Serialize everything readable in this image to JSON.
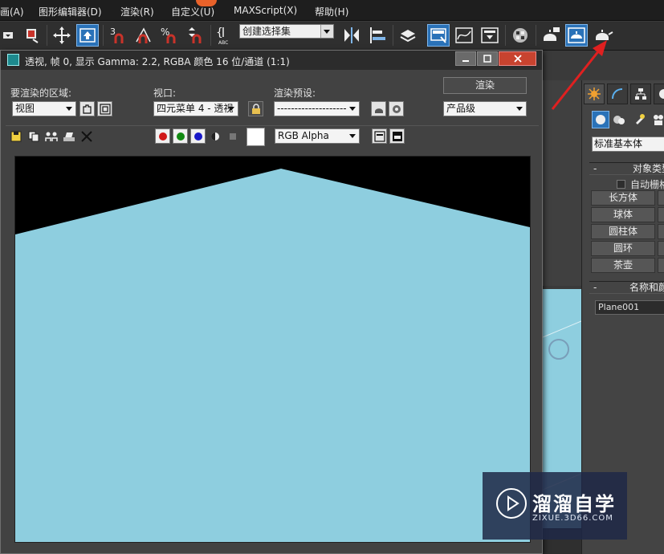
{
  "menu": {
    "items": [
      "画(A)",
      "图形编辑器(D)",
      "渲染(R)",
      "自定义(U)",
      "MAXScript(X)",
      "帮助(H)"
    ]
  },
  "toolbar": {
    "snap_labels": [
      "3",
      "%",
      "ABC"
    ],
    "named_selection_set": "创建选择集"
  },
  "render_window": {
    "title": "透视, 帧 0, 显示 Gamma: 2.2, RGBA 颜色 16 位/通道 (1:1)",
    "area_label": "要渲染的区域:",
    "area_value": "视图",
    "viewport_label": "视口:",
    "viewport_value": "四元菜单 4 - 透视",
    "preset_label": "渲染预设:",
    "preset_value": "--------------------",
    "render_button": "渲染",
    "quality_value": "产品级",
    "channel_value": "RGB Alpha",
    "channel_colors": {
      "red": "#d01818",
      "green": "#128a12",
      "blue": "#1818c8"
    },
    "sky_color": "#000000",
    "ground_color": "#8ecedf"
  },
  "command_panel": {
    "primitive_type": "标准基本体",
    "object_type_rollup": "对象类型",
    "autogrid_label": "自动栅格",
    "buttons": [
      "长方体",
      "球体",
      "圆柱体",
      "圆环",
      "茶壶"
    ],
    "name_color_rollup": "名称和颜色",
    "object_name": "Plane001"
  },
  "watermark": {
    "brand": "溜溜自学",
    "url": "ZIXUE.3D66.COM"
  },
  "colors": {
    "accent": "#2a72b8",
    "annotation_arrow": "#e02020"
  }
}
